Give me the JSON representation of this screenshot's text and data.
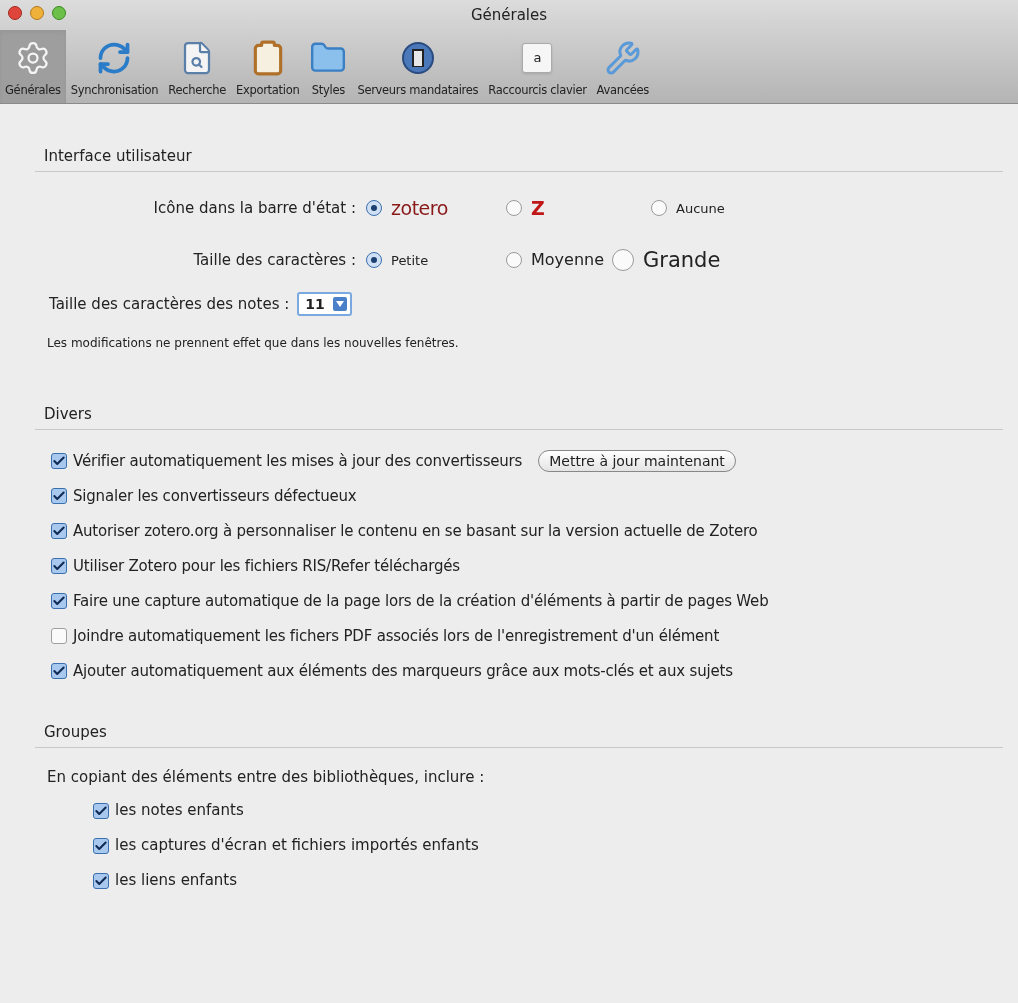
{
  "window": {
    "title": "Générales"
  },
  "toolbar": [
    {
      "label": "Générales",
      "kind": "gear",
      "selected": true
    },
    {
      "label": "Synchronisation",
      "kind": "sync",
      "selected": false
    },
    {
      "label": "Recherche",
      "kind": "search",
      "selected": false
    },
    {
      "label": "Exportation",
      "kind": "clipboard",
      "selected": false
    },
    {
      "label": "Styles",
      "kind": "folder",
      "selected": false
    },
    {
      "label": "Serveurs mandataires",
      "kind": "door",
      "selected": false
    },
    {
      "label": "Raccourcis clavier",
      "kind": "key",
      "key": "a",
      "selected": false
    },
    {
      "label": "Avancées",
      "kind": "tools",
      "selected": false
    }
  ],
  "interface": {
    "title": "Interface utilisateur",
    "radio_groups": [
      {
        "label": "Icône dans la barre d'état :",
        "options": [
          {
            "label": "zotero",
            "kind": "wordmark",
            "selected": true
          },
          {
            "label": "Z",
            "kind": "lettermark",
            "selected": false
          },
          {
            "label": "Aucune",
            "kind": "small",
            "selected": false
          }
        ]
      },
      {
        "label": "Taille des caractères :",
        "options": [
          {
            "label": "Petite",
            "kind": "small",
            "selected": true
          },
          {
            "label": "Moyenne",
            "kind": "medium",
            "selected": false
          },
          {
            "label": "Grande",
            "kind": "large",
            "selected": false
          }
        ]
      }
    ],
    "note_size": {
      "label": "Taille des caractères des notes :",
      "value": "11"
    },
    "note": "Les modifications ne prennent effet que dans les nouvelles fenêtres."
  },
  "misc": {
    "title": "Divers",
    "options": [
      {
        "label": "Vérifier automatiquement les mises à jour des convertisseurs",
        "checked": true,
        "button": "Mettre à jour maintenant"
      },
      {
        "label": "Signaler les convertisseurs défectueux",
        "checked": true
      },
      {
        "label": "Autoriser zotero.org à personnaliser le contenu en se basant sur la version actuelle de Zotero",
        "checked": true
      },
      {
        "label": "Utiliser Zotero pour les fichiers RIS/Refer téléchargés",
        "checked": true
      },
      {
        "label": "Faire une capture automatique de la page lors de la création d'éléments à partir de pages Web",
        "checked": true
      },
      {
        "label": "Joindre automatiquement les fichers PDF associés lors de l'enregistrement d'un élément",
        "checked": false
      },
      {
        "label": "Ajouter automatiquement aux éléments des marqueurs grâce aux mots-clés et aux sujets",
        "checked": true
      }
    ]
  },
  "groups": {
    "title": "Groupes",
    "intro": "En copiant des éléments entre des bibliothèques, inclure :",
    "options": [
      {
        "label": "les notes enfants",
        "checked": true
      },
      {
        "label": "les captures d'écran et fichiers importés enfants",
        "checked": true
      },
      {
        "label": "les liens enfants",
        "checked": true
      }
    ]
  }
}
